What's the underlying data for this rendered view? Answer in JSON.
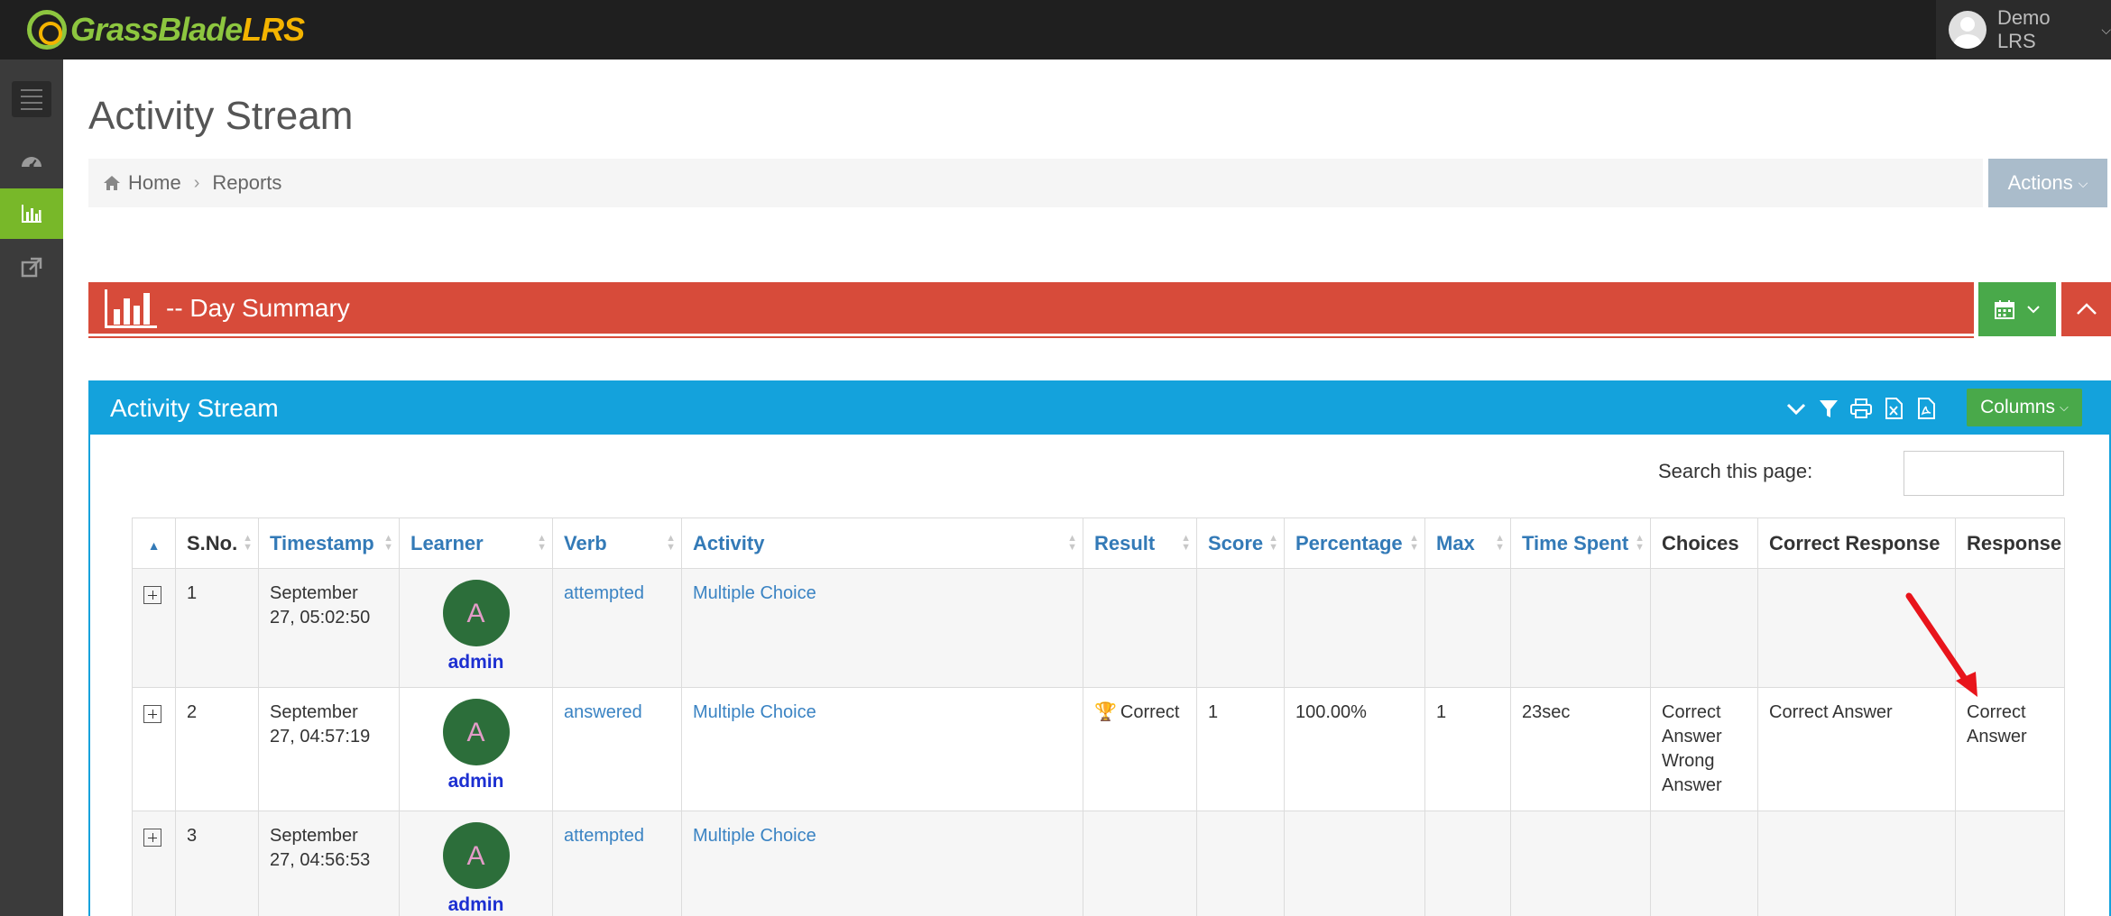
{
  "brand": {
    "name_part1": "GrassBlade",
    "name_part2": "LRS"
  },
  "user_menu": {
    "name": "Demo LRS"
  },
  "page": {
    "title": "Activity Stream"
  },
  "breadcrumb": {
    "home": "Home",
    "current": "Reports"
  },
  "actions": {
    "label": "Actions"
  },
  "day_summary": {
    "title": "-- Day Summary"
  },
  "panel": {
    "title": "Activity Stream",
    "columns_label": "Columns"
  },
  "search": {
    "label": "Search this page:",
    "value": ""
  },
  "table": {
    "headers": [
      "",
      "S.No.",
      "Timestamp",
      "Learner",
      "Verb",
      "Activity",
      "Result",
      "Score",
      "Percentage",
      "Max",
      "Time Spent",
      "Choices",
      "Correct Response",
      "Response"
    ],
    "rows": [
      {
        "sno": "1",
        "timestamp": "September 27, 05:02:50",
        "learner_initial": "A",
        "learner_name": "admin",
        "verb": "attempted",
        "activity": "Multiple Choice",
        "result": "",
        "score": "",
        "percentage": "",
        "max": "",
        "time_spent": "",
        "choices": [
          "",
          ""
        ],
        "correct_response": "",
        "response": ""
      },
      {
        "sno": "2",
        "timestamp": "September 27, 04:57:19",
        "learner_initial": "A",
        "learner_name": "admin",
        "verb": "answered",
        "activity": "Multiple Choice",
        "result": "Correct",
        "score": "1",
        "percentage": "100.00%",
        "max": "1",
        "time_spent": "23sec",
        "choices": [
          "Correct Answer",
          "Wrong Answer"
        ],
        "correct_response": "Correct Answer",
        "response": "Correct Answer"
      },
      {
        "sno": "3",
        "timestamp": "September 27, 04:56:53",
        "learner_initial": "A",
        "learner_name": "admin",
        "verb": "attempted",
        "activity": "Multiple Choice",
        "result": "",
        "score": "",
        "percentage": "",
        "max": "",
        "time_spent": "",
        "choices": [
          "",
          ""
        ],
        "correct_response": "",
        "response": ""
      }
    ]
  },
  "colors": {
    "topbar": "#1f1f1f",
    "sidebar": "#3b3b3b",
    "accent_green": "#78b829",
    "summary_red": "#d74b3a",
    "panel_blue": "#14a2dc",
    "link_blue": "#337ab7",
    "annotation_red": "#e8141b"
  },
  "icons": [
    "menu-icon",
    "dashboard-icon",
    "bar-chart-icon",
    "external-link-icon",
    "home-icon",
    "calendar-icon",
    "chevron-down-icon",
    "chevron-up-icon",
    "filter-icon",
    "print-icon",
    "excel-icon",
    "pdf-icon",
    "trophy-icon",
    "expand-icon"
  ]
}
